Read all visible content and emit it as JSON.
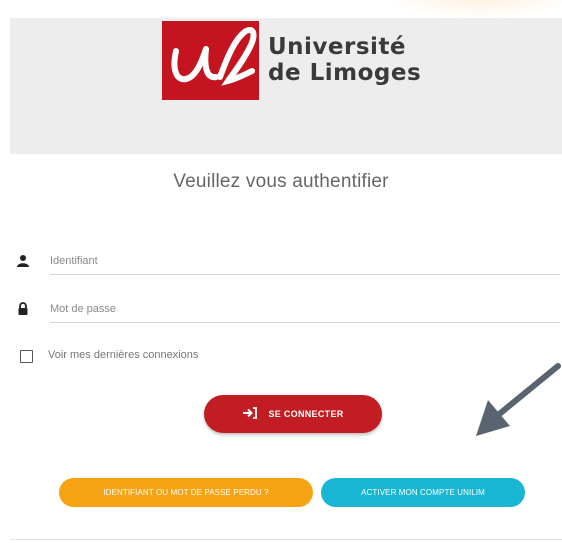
{
  "header": {
    "logo_line1": "Université",
    "logo_line2": "de Limoges"
  },
  "page": {
    "title": "Veuillez vous authentifier"
  },
  "form": {
    "username_placeholder": "Identifiant",
    "password_placeholder": "Mot de passe",
    "checkbox_label": "Voir mes dernières connexions",
    "submit_label": "SE CONNECTER"
  },
  "links": {
    "lost_label": "IDENTIFIANT OU MOT DE PASSE PERDU ?",
    "activate_label": "ACTIVER MON COMPTE UNILIM"
  },
  "colors": {
    "brand_red": "#c3141f",
    "connect_button": "#c21d22",
    "lost_button": "#f6a313",
    "activate_button": "#18b6d3",
    "header_bg": "#ededed",
    "annotation_arrow": "#5a6470"
  },
  "icons": {
    "username": "user-icon",
    "password": "lock-icon",
    "submit": "sign-in-icon",
    "annotation": "arrow-icon"
  }
}
